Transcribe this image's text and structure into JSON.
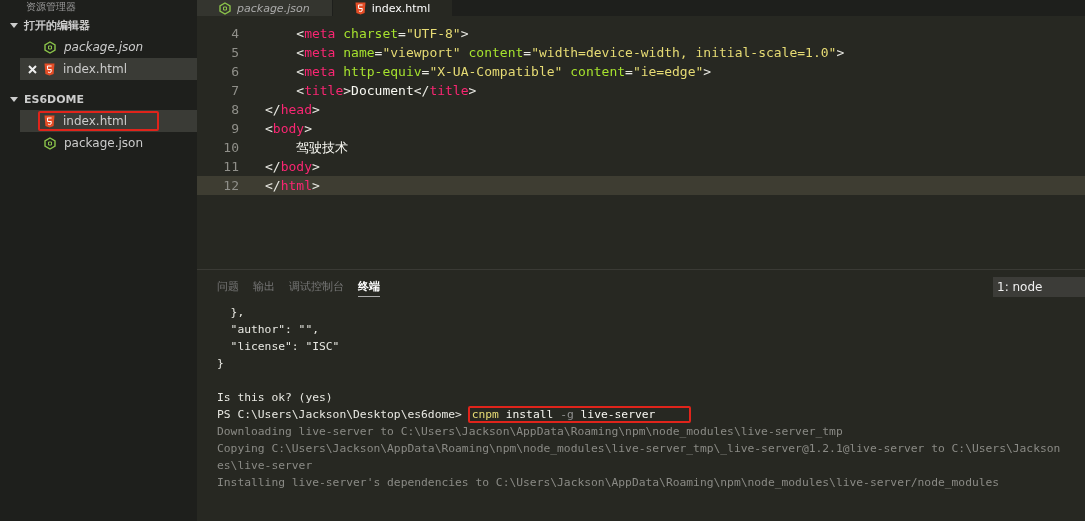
{
  "sidebar": {
    "title": "资源管理器",
    "sections": [
      {
        "title": "打开的编辑器",
        "expanded": true,
        "items": [
          {
            "label": "package.json",
            "kind": "json",
            "preview": true,
            "selected": false,
            "closable": false,
            "highlighted": false
          },
          {
            "label": "index.html",
            "kind": "html",
            "preview": false,
            "selected": true,
            "closable": true,
            "highlighted": false
          }
        ]
      },
      {
        "title": "ES6DOME",
        "expanded": true,
        "items": [
          {
            "label": "index.html",
            "kind": "html",
            "preview": false,
            "selected": true,
            "closable": false,
            "highlighted": true
          },
          {
            "label": "package.json",
            "kind": "json",
            "preview": false,
            "selected": false,
            "closable": false,
            "highlighted": false
          }
        ]
      }
    ]
  },
  "tabs": [
    {
      "label": "package.json",
      "kind": "json",
      "selected": false
    },
    {
      "label": "index.html",
      "kind": "html",
      "selected": true
    }
  ],
  "editor": {
    "lines": [
      {
        "number": "4",
        "current": false,
        "tokens": [
          {
            "kind": "punct",
            "text": "    <"
          },
          {
            "kind": "tag",
            "text": "meta"
          },
          {
            "kind": "attr",
            "text": " charset"
          },
          {
            "kind": "punct",
            "text": "="
          },
          {
            "kind": "string",
            "text": "\"UTF-8\""
          },
          {
            "kind": "punct",
            "text": ">"
          }
        ]
      },
      {
        "number": "5",
        "current": false,
        "tokens": [
          {
            "kind": "punct",
            "text": "    <"
          },
          {
            "kind": "tag",
            "text": "meta"
          },
          {
            "kind": "attr",
            "text": " name"
          },
          {
            "kind": "punct",
            "text": "="
          },
          {
            "kind": "string",
            "text": "\"viewport\""
          },
          {
            "kind": "attr",
            "text": " content"
          },
          {
            "kind": "punct",
            "text": "="
          },
          {
            "kind": "string",
            "text": "\"width=device-width, initial-scale=1.0\""
          },
          {
            "kind": "punct",
            "text": ">"
          }
        ]
      },
      {
        "number": "6",
        "current": false,
        "tokens": [
          {
            "kind": "punct",
            "text": "    <"
          },
          {
            "kind": "tag",
            "text": "meta"
          },
          {
            "kind": "attr",
            "text": " http-equiv"
          },
          {
            "kind": "punct",
            "text": "="
          },
          {
            "kind": "string",
            "text": "\"X-UA-Compatible\""
          },
          {
            "kind": "attr",
            "text": " content"
          },
          {
            "kind": "punct",
            "text": "="
          },
          {
            "kind": "string",
            "text": "\"ie=edge\""
          },
          {
            "kind": "punct",
            "text": ">"
          }
        ]
      },
      {
        "number": "7",
        "current": false,
        "tokens": [
          {
            "kind": "punct",
            "text": "    <"
          },
          {
            "kind": "tag",
            "text": "title"
          },
          {
            "kind": "punct",
            "text": ">"
          },
          {
            "kind": "text",
            "text": "Document"
          },
          {
            "kind": "punct",
            "text": "</"
          },
          {
            "kind": "tag",
            "text": "title"
          },
          {
            "kind": "punct",
            "text": ">"
          }
        ]
      },
      {
        "number": "8",
        "current": false,
        "tokens": [
          {
            "kind": "punct",
            "text": "</"
          },
          {
            "kind": "tag",
            "text": "head"
          },
          {
            "kind": "punct",
            "text": ">"
          }
        ]
      },
      {
        "number": "9",
        "current": false,
        "tokens": [
          {
            "kind": "punct",
            "text": "<"
          },
          {
            "kind": "tag",
            "text": "body"
          },
          {
            "kind": "punct",
            "text": ">"
          }
        ]
      },
      {
        "number": "10",
        "current": false,
        "tokens": [
          {
            "kind": "text",
            "text": "    驾驶技术"
          }
        ]
      },
      {
        "number": "11",
        "current": false,
        "tokens": [
          {
            "kind": "punct",
            "text": "</"
          },
          {
            "kind": "tag",
            "text": "body"
          },
          {
            "kind": "punct",
            "text": ">"
          }
        ]
      },
      {
        "number": "12",
        "current": true,
        "tokens": [
          {
            "kind": "punct",
            "text": "</"
          },
          {
            "kind": "tag",
            "text": "html"
          },
          {
            "kind": "punct",
            "text": ">"
          }
        ]
      }
    ]
  },
  "panel": {
    "tabs": [
      {
        "label": "问题",
        "selected": false
      },
      {
        "label": "输出",
        "selected": false
      },
      {
        "label": "调试控制台",
        "selected": false
      },
      {
        "label": "终端",
        "selected": true
      }
    ],
    "terminal_select": "1: node",
    "terminal": [
      {
        "kind": "output",
        "text": "  },"
      },
      {
        "kind": "output",
        "text": "  \"author\": \"\","
      },
      {
        "kind": "output",
        "text": "  \"license\": \"ISC\""
      },
      {
        "kind": "output",
        "text": "}"
      },
      {
        "kind": "blank"
      },
      {
        "kind": "output",
        "text": "Is this ok? (yes)"
      },
      {
        "kind": "prompt",
        "prompt": "PS C:\\Users\\Jackson\\Desktop\\es6dome>",
        "highlighted": true,
        "command": [
          {
            "kind": "program",
            "text": "cnpm"
          },
          {
            "kind": "word",
            "text": "install"
          },
          {
            "kind": "flag",
            "text": "-g"
          },
          {
            "kind": "word",
            "text": "live-server"
          }
        ]
      },
      {
        "kind": "dim",
        "text": "Downloading live-server to C:\\Users\\Jackson\\AppData\\Roaming\\npm\\node_modules\\live-server_tmp"
      },
      {
        "kind": "dim",
        "text": "Copying C:\\Users\\Jackson\\AppData\\Roaming\\npm\\node_modules\\live-server_tmp\\_live-server@1.2.1@live-server to C:\\Users\\Jackson"
      },
      {
        "kind": "dim",
        "text": "es\\live-server"
      },
      {
        "kind": "dim",
        "text": "Installing live-server's dependencies to C:\\Users\\Jackson\\AppData\\Roaming\\npm\\node_modules\\live-server/node_modules"
      }
    ]
  }
}
